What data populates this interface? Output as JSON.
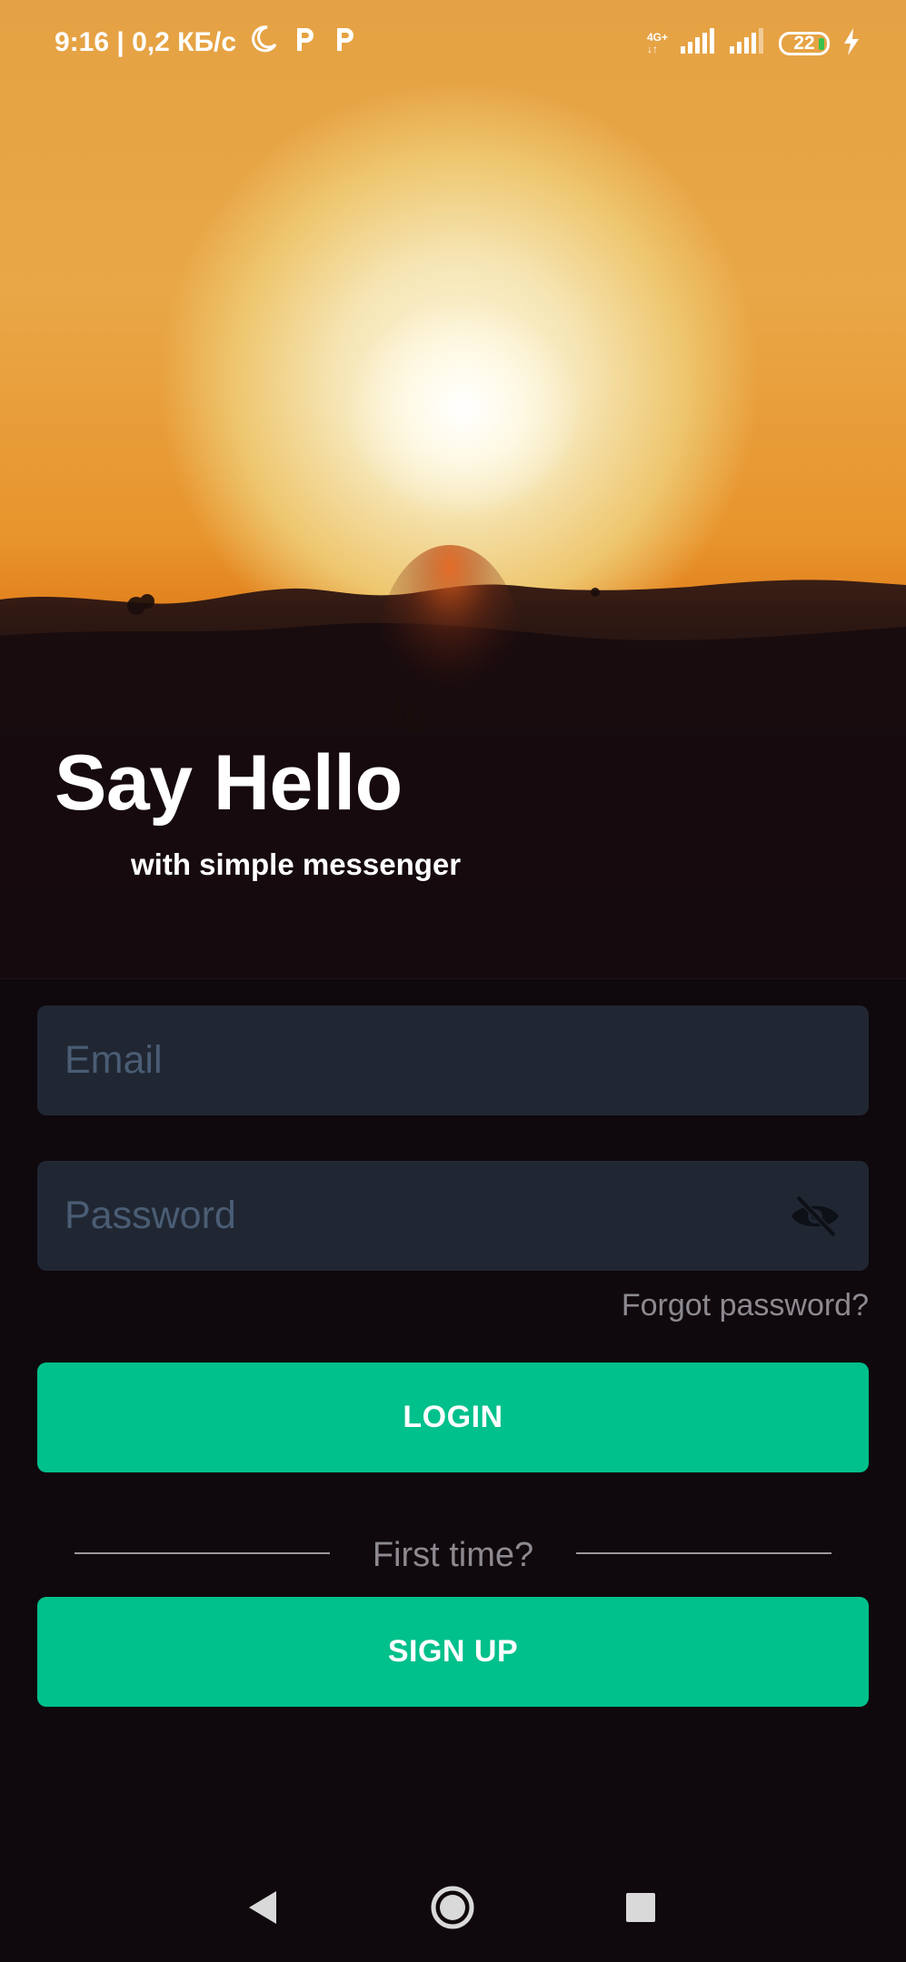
{
  "status_bar": {
    "time_speed": "9:16 | 0,2 КБ/с",
    "network_type_top": "4G+",
    "network_type_bottom": "↓↑",
    "battery_level": "22",
    "icons": [
      "moon-icon",
      "p-app-icon",
      "p-app-icon",
      "signal-icon",
      "signal-icon",
      "battery-icon",
      "charging-icon"
    ]
  },
  "hero": {
    "title": "Say Hello",
    "subtitle": "with simple messenger"
  },
  "form": {
    "email_placeholder": "Email",
    "password_placeholder": "Password",
    "forgot_password": "Forgot password?",
    "login_label": "LOGIN",
    "separator_text": "First time?",
    "signup_label": "SIGN UP"
  },
  "nav_bar": {
    "icons": [
      "back-icon",
      "home-icon",
      "recents-icon"
    ]
  },
  "colors": {
    "accent": "#00c08b",
    "background": "#0f080d",
    "input_background": "#202733",
    "placeholder": "#4a5d74",
    "muted_text": "#8c8a90"
  }
}
